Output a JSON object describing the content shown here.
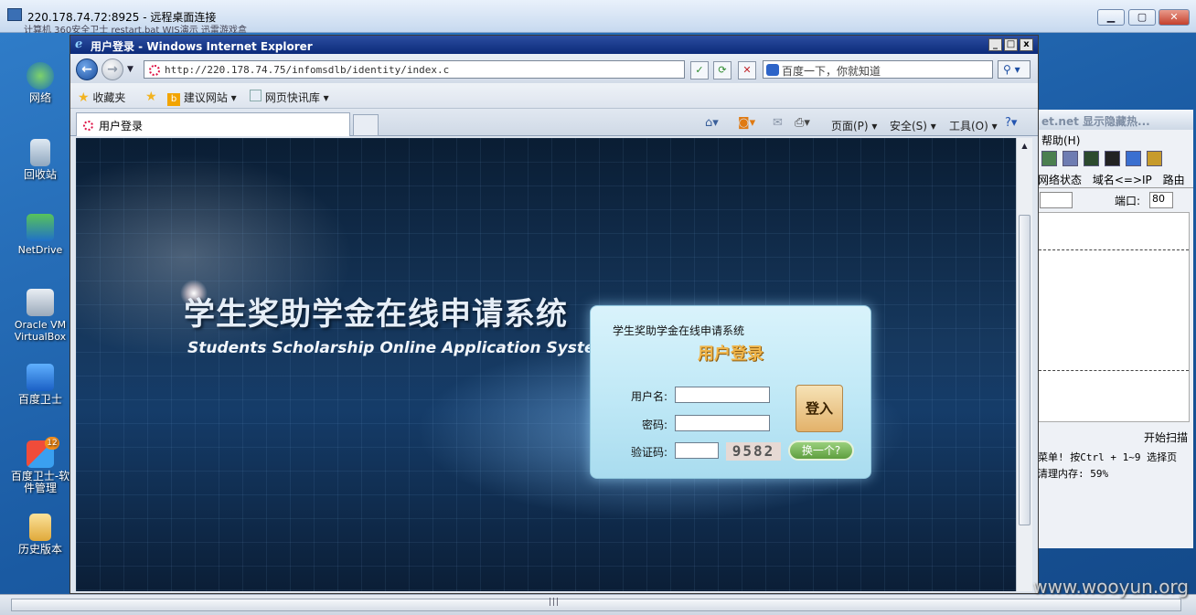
{
  "rdp": {
    "title": "220.178.74.72:8925 - 远程桌面连接",
    "strip_text": "计算机    360安全卫士   restart.bat    WIS演示    迅雷游戏盒",
    "btn_min": "▁",
    "btn_max": "▢",
    "btn_close": "✕"
  },
  "desktop": {
    "icons": [
      {
        "label": "网络"
      },
      {
        "label": "回收站"
      },
      {
        "label": "NetDrive"
      },
      {
        "label": "Oracle VM VirtualBox"
      },
      {
        "label": "百度卫士"
      },
      {
        "label": "百度卫士-软件管理"
      },
      {
        "label": "历史版本"
      }
    ],
    "badge": "12"
  },
  "bgapp": {
    "title": "et.net  显示隐藏热...",
    "menu": "帮助(H)",
    "tabs": [
      "网络状态",
      "域名<=>IP",
      "路由"
    ],
    "port_label": "端口:",
    "port_value": "80",
    "scan_btn": "开始扫描",
    "status1": "菜单! 按Ctrl + 1~9  选择页",
    "status2": "清理内存: 59%"
  },
  "ie": {
    "title": "用户登录 - Windows Internet Explorer",
    "url": "http://220.178.74.75/infomsdlb/identity/index.c",
    "search_placeholder": "百度一下，你就知道",
    "favorites_label": "收藏夹",
    "fav_items": [
      "建议网站 ▾",
      "网页快讯库 ▾"
    ],
    "tab_label": "用户登录",
    "commands": {
      "page": "页面(P) ▾",
      "safety": "安全(S) ▾",
      "tools": "工具(O) ▾"
    }
  },
  "page": {
    "hero_cn": "学生奖助学金在线申请系统",
    "hero_en": "Students  Scholarship  Online  Application  System",
    "login": {
      "system_name": "学生奖助学金在线申请系统",
      "heading": "用户登录",
      "username_label": "用户名:",
      "password_label": "密码:",
      "captcha_label": "验证码:",
      "captcha_value": "9582",
      "login_button": "登入",
      "refresh_button": "换一个?"
    }
  },
  "watermark": "www.wooyun.org",
  "colors": {
    "ie_title": "#0b2a7a",
    "login_heading": "#f0b54a",
    "panel": "#bfe8f6"
  }
}
